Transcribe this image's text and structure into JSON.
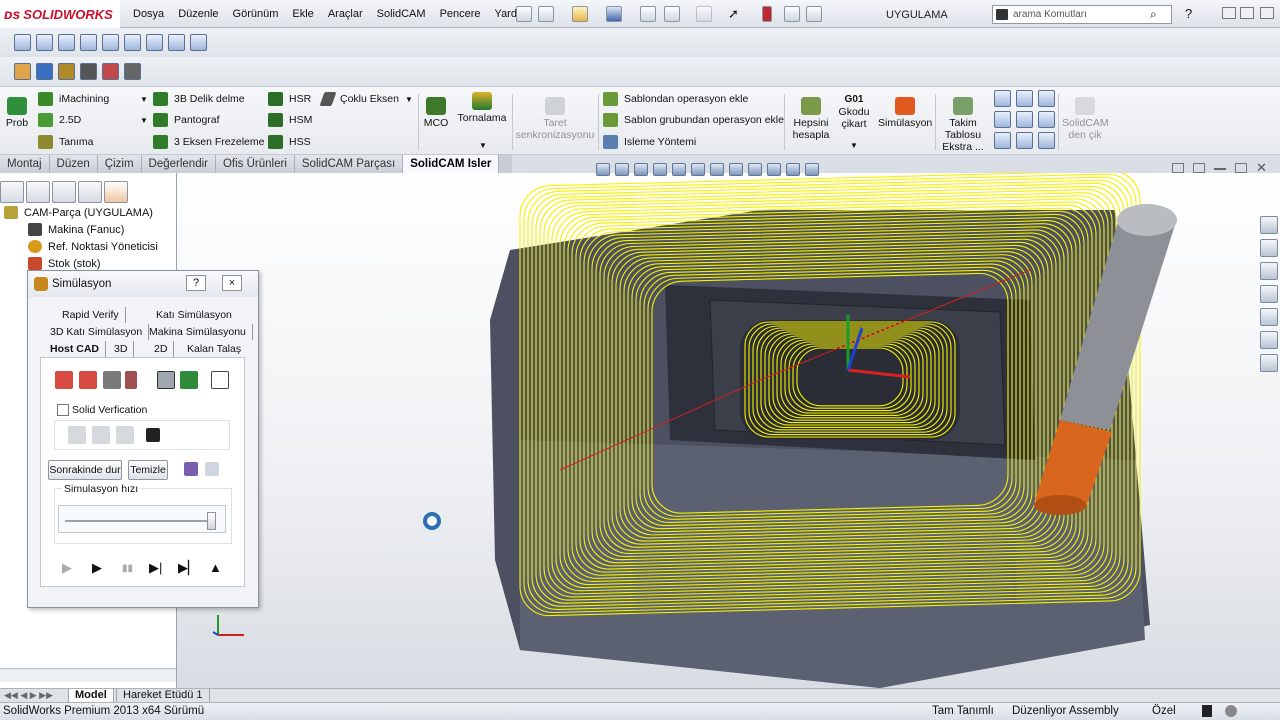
{
  "app": {
    "brand": "SOLIDWORKS",
    "document_title": "UYGULAMA"
  },
  "menu": [
    "Dosya",
    "Düzenle",
    "Görünüm",
    "Ekle",
    "Araçlar",
    "SolidCAM",
    "Pencere",
    "Yardım"
  ],
  "search": {
    "placeholder": "arama Komutları"
  },
  "cam_commands": {
    "prob": "Prob",
    "imachining": "iMachining",
    "d25": "2.5D",
    "tanima": "Tanıma",
    "delik": "3B Delik delme",
    "pantograf": "Pantograf",
    "eksen3": "3 Eksen Frezeleme",
    "hsr": "HSR",
    "hsm": "HSM",
    "hss": "HSS",
    "coklu": "Çoklu Eksen",
    "mco": "MCO",
    "tornalama": "Tornalama",
    "taret": "Taret\nsenkronizasyonu",
    "sablon1": "Sablondan operasyon ekle",
    "sablon2": "Sablon grubundan operasyon ekle",
    "isleme": "Isleme Yöntemi",
    "hepsini": "Hepsini\nhesapla",
    "g01": "G01",
    "gkodu": "Gkodu\nçikart",
    "simulasyon": "Simülasyon",
    "takim": "Takim\nTablosu\nEkstra ...",
    "cik": "SolidCAM\nden çik"
  },
  "ribbon_tabs": [
    {
      "label": "Montaj",
      "active": false
    },
    {
      "label": "Düzen",
      "active": false
    },
    {
      "label": "Çizim",
      "active": false
    },
    {
      "label": "Değerlendir",
      "active": false
    },
    {
      "label": "Ofis Ürünleri",
      "active": false
    },
    {
      "label": "SolidCAM Parçası",
      "active": false
    },
    {
      "label": "SolidCAM Isler",
      "active": true
    }
  ],
  "tree": [
    {
      "label": "CAM-Parça (UYGULAMA)",
      "color": "#b8a23a"
    },
    {
      "label": "Makina (Fanuc)",
      "color": "#444"
    },
    {
      "label": "Ref. Noktasi Yöneticisi",
      "color": "#d99a1c"
    },
    {
      "label": "Stok (stok)",
      "color": "#c9492c"
    }
  ],
  "sim_dialog": {
    "title": "Simülasyon",
    "help": "?",
    "close": "×",
    "tabs_row1": [
      "Rapid Verify",
      "Katı Simülasyon"
    ],
    "tabs_row2": [
      "3D Katı Simülasyon",
      "Makina Simülasyonu"
    ],
    "tabs_row3": [
      "Host CAD",
      "3D",
      "2D",
      "Kalan Talaş"
    ],
    "solid_verification": "Solid Verfication",
    "btn_stop": "Sonrakinde dur",
    "btn_clear": "Temizle",
    "speed_label": "Simulasyon hızı",
    "speed_level": 1.0
  },
  "bottom_tabs": [
    "Model",
    "Hareket Etüdü 1"
  ],
  "status": {
    "product": "SolidWorks Premium 2013 x64 Sürümü",
    "definition": "Tam Tanımlı",
    "mode": "Düzenliyor Assembly",
    "units": "Özel"
  }
}
